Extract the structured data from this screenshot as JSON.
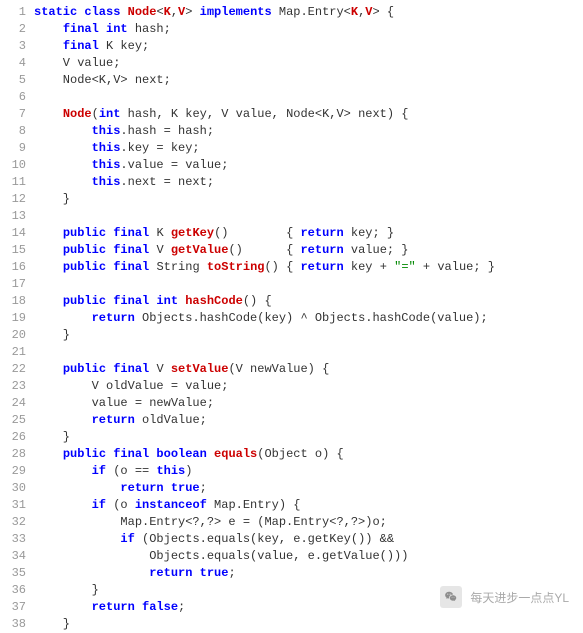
{
  "code": {
    "lines": [
      {
        "n": 1,
        "segs": [
          {
            "t": "static class ",
            "c": "kw"
          },
          {
            "t": "Node",
            "c": "mred"
          },
          {
            "t": "<"
          },
          {
            "t": "K",
            "c": "mred"
          },
          {
            "t": ","
          },
          {
            "t": "V",
            "c": "mred"
          },
          {
            "t": "> "
          },
          {
            "t": "implements ",
            "c": "kw"
          },
          {
            "t": "Map.Entry<"
          },
          {
            "t": "K",
            "c": "mred"
          },
          {
            "t": ","
          },
          {
            "t": "V",
            "c": "mred"
          },
          {
            "t": "> {"
          }
        ]
      },
      {
        "n": 2,
        "segs": [
          {
            "t": "    "
          },
          {
            "t": "final int ",
            "c": "kw"
          },
          {
            "t": "hash;"
          }
        ]
      },
      {
        "n": 3,
        "segs": [
          {
            "t": "    "
          },
          {
            "t": "final ",
            "c": "kw"
          },
          {
            "t": "K key;"
          }
        ]
      },
      {
        "n": 4,
        "segs": [
          {
            "t": "    V value;"
          }
        ]
      },
      {
        "n": 5,
        "segs": [
          {
            "t": "    Node<K,V> next;"
          }
        ]
      },
      {
        "n": 6,
        "segs": [
          {
            "t": " "
          }
        ]
      },
      {
        "n": 7,
        "segs": [
          {
            "t": "    "
          },
          {
            "t": "Node",
            "c": "mred"
          },
          {
            "t": "("
          },
          {
            "t": "int ",
            "c": "kw"
          },
          {
            "t": "hash, K key, V value, Node<K,V> next) {"
          }
        ]
      },
      {
        "n": 8,
        "segs": [
          {
            "t": "        "
          },
          {
            "t": "this",
            "c": "kw"
          },
          {
            "t": ".hash = hash;"
          }
        ]
      },
      {
        "n": 9,
        "segs": [
          {
            "t": "        "
          },
          {
            "t": "this",
            "c": "kw"
          },
          {
            "t": ".key = key;"
          }
        ]
      },
      {
        "n": 10,
        "segs": [
          {
            "t": "        "
          },
          {
            "t": "this",
            "c": "kw"
          },
          {
            "t": ".value = value;"
          }
        ]
      },
      {
        "n": 11,
        "segs": [
          {
            "t": "        "
          },
          {
            "t": "this",
            "c": "kw"
          },
          {
            "t": ".next = next;"
          }
        ]
      },
      {
        "n": 12,
        "segs": [
          {
            "t": "    }"
          }
        ]
      },
      {
        "n": 13,
        "segs": [
          {
            "t": " "
          }
        ]
      },
      {
        "n": 14,
        "segs": [
          {
            "t": "    "
          },
          {
            "t": "public final ",
            "c": "kw"
          },
          {
            "t": "K "
          },
          {
            "t": "getKey",
            "c": "mred"
          },
          {
            "t": "()        { "
          },
          {
            "t": "return ",
            "c": "kw"
          },
          {
            "t": "key; }"
          }
        ]
      },
      {
        "n": 15,
        "segs": [
          {
            "t": "    "
          },
          {
            "t": "public final ",
            "c": "kw"
          },
          {
            "t": "V "
          },
          {
            "t": "getValue",
            "c": "mred"
          },
          {
            "t": "()      { "
          },
          {
            "t": "return ",
            "c": "kw"
          },
          {
            "t": "value; }"
          }
        ]
      },
      {
        "n": 16,
        "segs": [
          {
            "t": "    "
          },
          {
            "t": "public final ",
            "c": "kw"
          },
          {
            "t": "String "
          },
          {
            "t": "toString",
            "c": "mred"
          },
          {
            "t": "() { "
          },
          {
            "t": "return ",
            "c": "kw"
          },
          {
            "t": "key + "
          },
          {
            "t": "\"=\"",
            "c": "str"
          },
          {
            "t": " + value; }"
          }
        ]
      },
      {
        "n": 17,
        "segs": [
          {
            "t": " "
          }
        ]
      },
      {
        "n": 18,
        "segs": [
          {
            "t": "    "
          },
          {
            "t": "public final int ",
            "c": "kw"
          },
          {
            "t": "hashCode",
            "c": "mred"
          },
          {
            "t": "() {"
          }
        ]
      },
      {
        "n": 19,
        "segs": [
          {
            "t": "        "
          },
          {
            "t": "return ",
            "c": "kw"
          },
          {
            "t": "Objects.hashCode(key) ^ Objects.hashCode(value);"
          }
        ]
      },
      {
        "n": 20,
        "segs": [
          {
            "t": "    }"
          }
        ]
      },
      {
        "n": 21,
        "segs": [
          {
            "t": " "
          }
        ]
      },
      {
        "n": 22,
        "segs": [
          {
            "t": "    "
          },
          {
            "t": "public final ",
            "c": "kw"
          },
          {
            "t": "V "
          },
          {
            "t": "setValue",
            "c": "mred"
          },
          {
            "t": "(V newValue) {"
          }
        ]
      },
      {
        "n": 23,
        "segs": [
          {
            "t": "        V oldValue = value;"
          }
        ]
      },
      {
        "n": 24,
        "segs": [
          {
            "t": "        value = newValue;"
          }
        ]
      },
      {
        "n": 25,
        "segs": [
          {
            "t": "        "
          },
          {
            "t": "return ",
            "c": "kw"
          },
          {
            "t": "oldValue;"
          }
        ]
      },
      {
        "n": 26,
        "segs": [
          {
            "t": "    }"
          }
        ]
      },
      {
        "n": 28,
        "segs": [
          {
            "t": "    "
          },
          {
            "t": "public final boolean ",
            "c": "kw"
          },
          {
            "t": "equals",
            "c": "mred"
          },
          {
            "t": "(Object o) {"
          }
        ]
      },
      {
        "n": 29,
        "segs": [
          {
            "t": "        "
          },
          {
            "t": "if ",
            "c": "kw"
          },
          {
            "t": "(o == "
          },
          {
            "t": "this",
            "c": "kw"
          },
          {
            "t": ")"
          }
        ]
      },
      {
        "n": 30,
        "segs": [
          {
            "t": "            "
          },
          {
            "t": "return true",
            "c": "kw"
          },
          {
            "t": ";"
          }
        ]
      },
      {
        "n": 31,
        "segs": [
          {
            "t": "        "
          },
          {
            "t": "if ",
            "c": "kw"
          },
          {
            "t": "(o "
          },
          {
            "t": "instanceof ",
            "c": "kw"
          },
          {
            "t": "Map.Entry) {"
          }
        ]
      },
      {
        "n": 32,
        "segs": [
          {
            "t": "            Map.Entry<?,?> e = (Map.Entry<?,?>)o;"
          }
        ]
      },
      {
        "n": 33,
        "segs": [
          {
            "t": "            "
          },
          {
            "t": "if ",
            "c": "kw"
          },
          {
            "t": "(Objects.equals(key, e.getKey()) &&"
          }
        ]
      },
      {
        "n": 34,
        "segs": [
          {
            "t": "                Objects.equals(value, e.getValue()))"
          }
        ]
      },
      {
        "n": 35,
        "segs": [
          {
            "t": "                "
          },
          {
            "t": "return true",
            "c": "kw"
          },
          {
            "t": ";"
          }
        ]
      },
      {
        "n": 36,
        "segs": [
          {
            "t": "        }"
          }
        ]
      },
      {
        "n": 37,
        "segs": [
          {
            "t": "        "
          },
          {
            "t": "return false",
            "c": "kw"
          },
          {
            "t": ";"
          }
        ]
      },
      {
        "n": 38,
        "segs": [
          {
            "t": "    }"
          }
        ]
      }
    ]
  },
  "watermark": {
    "text": "每天进步一点点YL"
  }
}
